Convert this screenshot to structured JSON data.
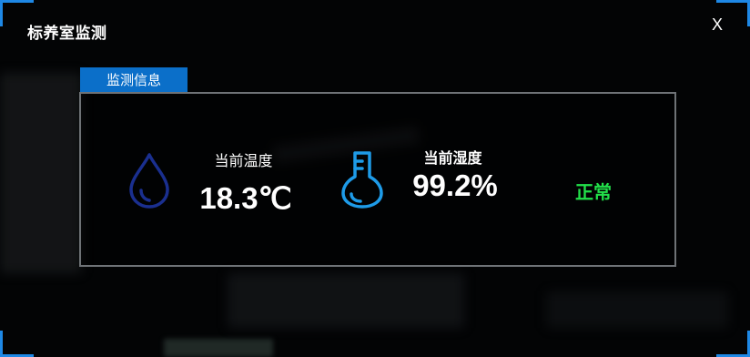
{
  "window": {
    "title": "标养室监测",
    "close_label": "X"
  },
  "panel": {
    "tab_label": "监测信息"
  },
  "temperature": {
    "label": "当前温度",
    "value": "18.3℃",
    "icon": "water-drop-icon"
  },
  "humidity": {
    "label": "当前湿度",
    "value": "99.2%",
    "icon": "thermometer-icon"
  },
  "status": {
    "text": "正常",
    "color": "#22e04a"
  },
  "colors": {
    "accent": "#1e88e5",
    "tab_background": "#0b6fc9",
    "drop_icon": "#1a2f8f",
    "thermometer_icon": "#1e9be8"
  }
}
